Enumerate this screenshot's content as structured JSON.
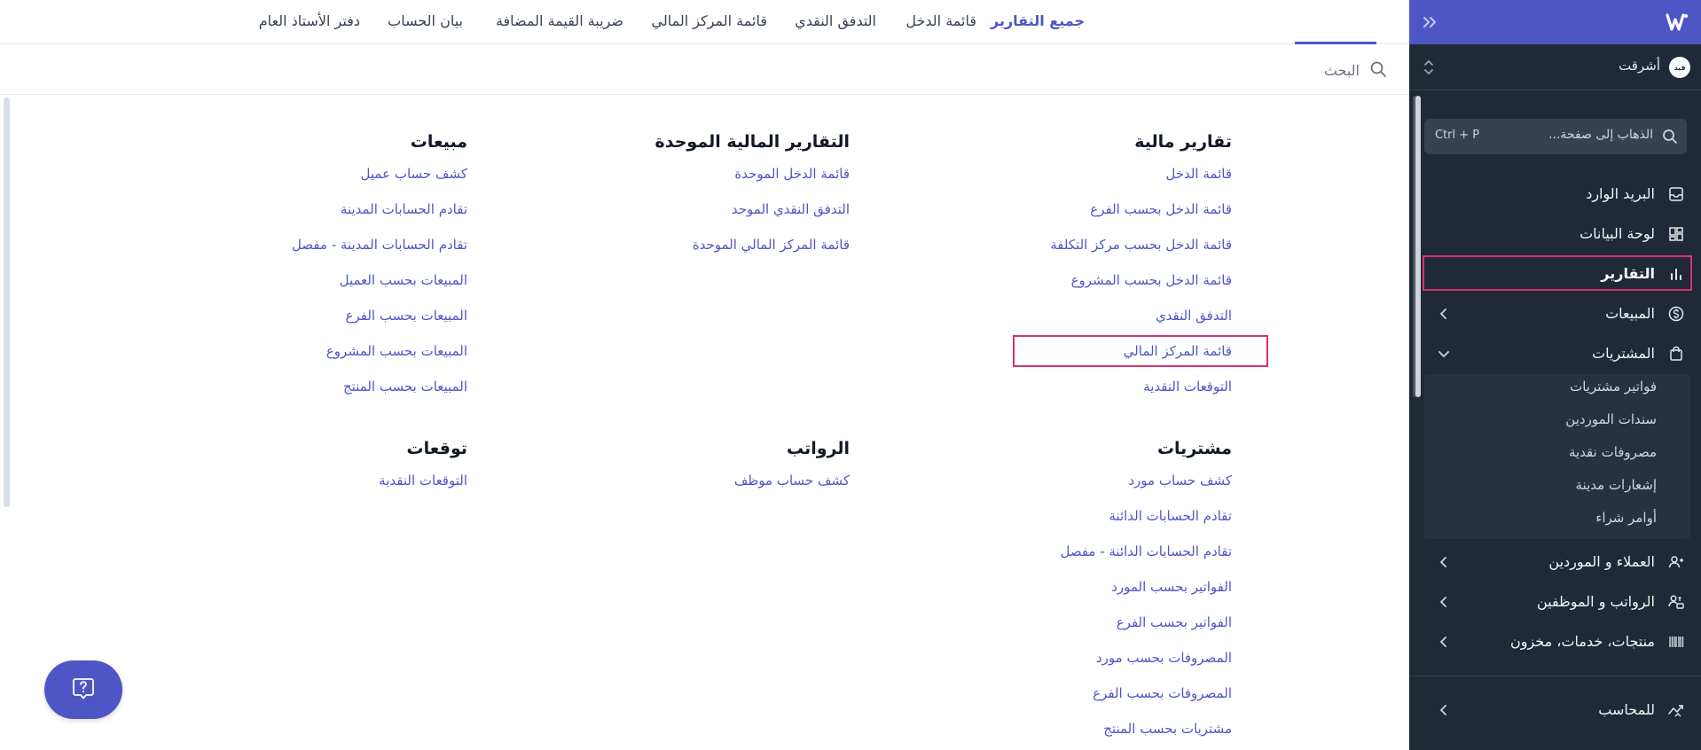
{
  "sidebar": {
    "org_name": "أشرقت",
    "org_avatar_text": "ﻗﻴﺪ",
    "nav_search": {
      "placeholder": "الذهاب إلى صفحة...",
      "shortcut": "Ctrl + P"
    },
    "items": {
      "inbox": "البريد الوارد",
      "dashboard": "لوحة البيانات",
      "reports": "التقارير",
      "sales": "المبيعات",
      "purchases": "المشتريات",
      "customers_suppliers": "العملاء و الموردين",
      "payroll_employees": "الرواتب و الموظفين",
      "products": "منتجات، خدمات، مخزون",
      "accountant": "للمحاسب"
    },
    "purchases_sub": [
      "فواتير مشتريات",
      "سندات الموردين",
      "مصروفات نقدية",
      "إشعارات مدينة",
      "أوامر شراء"
    ]
  },
  "tabs": [
    "جميع التقارير",
    "قائمة الدخل",
    "التدفق النقدي",
    "قائمة المركز المالي",
    "ضريبة القيمة المضافة",
    "بيان الحساب",
    "دفتر الأستاذ العام"
  ],
  "search": {
    "placeholder": "البحث"
  },
  "sections": {
    "financial": {
      "title": "تقارير مالية",
      "links": [
        "قائمة الدخل",
        "قائمة الدخل بحسب الفرع",
        "قائمة الدخل بحسب مركز التكلفة",
        "قائمة الدخل بحسب المشروع",
        "التدفق النقدي",
        "قائمة المركز المالي",
        "التوقعات النقدية"
      ]
    },
    "consolidated": {
      "title": "التقارير المالية الموحدة",
      "links": [
        "قائمة الدخل الموحدة",
        "التدفق النقدي الموحد",
        "قائمة المركز المالي الموحدة"
      ]
    },
    "sales": {
      "title": "مبيعات",
      "links": [
        "كشف حساب عميل",
        "تقادم الحسابات المدينة",
        "تقادم الحسابات المدينة - مفصل",
        "المبيعات بحسب العميل",
        "المبيعات بحسب الفرع",
        "المبيعات بحسب المشروع",
        "المبيعات بحسب المنتج"
      ]
    },
    "purchases": {
      "title": "مشتريات",
      "links": [
        "كشف حساب مورد",
        "تقادم الحسابات الدائنة",
        "تقادم الحسابات الدائنة - مفصل",
        "الفواتير بحسب المورد",
        "الفواتير بحسب الفرع",
        "المصروفات بحسب مورد",
        "المصروفات بحسب الفرع",
        "مشتريات بحسب المنتج"
      ]
    },
    "payroll": {
      "title": "الرواتب",
      "links": [
        "كشف حساب موظف"
      ]
    },
    "forecasts": {
      "title": "توقعات",
      "links": [
        "التوقعات النقدية"
      ]
    }
  },
  "colors": {
    "brand": "#4e56c5",
    "sidebar": "#1f2937",
    "highlight": "#d6336c"
  }
}
